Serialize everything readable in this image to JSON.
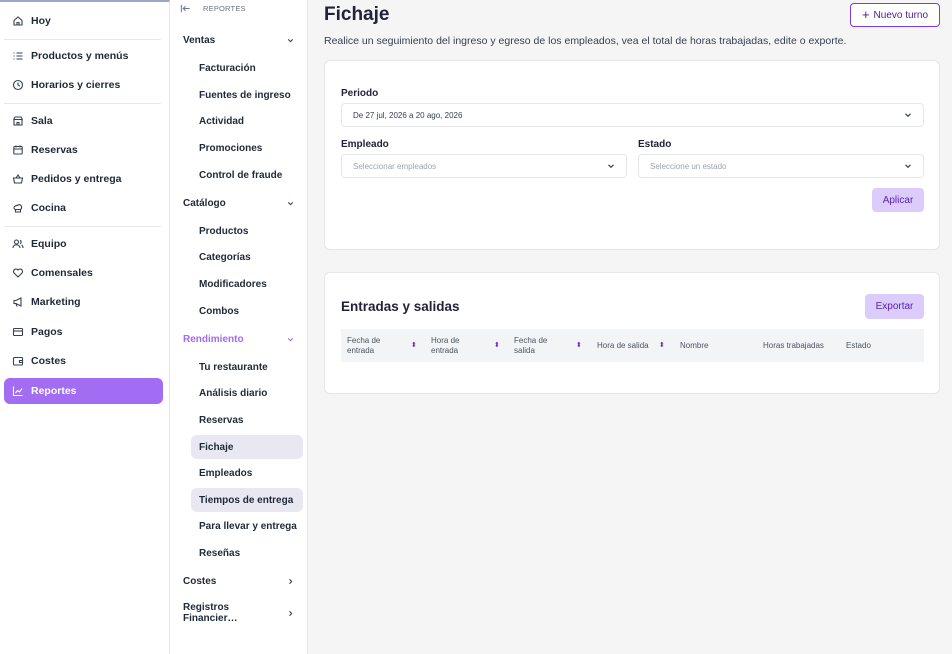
{
  "nav": {
    "items": [
      {
        "label": "Hoy",
        "icon": "home-icon"
      },
      {
        "label": "Productos y menús",
        "icon": "list-icon"
      },
      {
        "label": "Horarios y cierres",
        "icon": "clock-icon"
      },
      {
        "label": "Sala",
        "icon": "store-icon"
      },
      {
        "label": "Reservas",
        "icon": "calendar-icon"
      },
      {
        "label": "Pedidos y entrega",
        "icon": "basket-icon"
      },
      {
        "label": "Cocina",
        "icon": "chef-hat-icon"
      },
      {
        "label": "Equipo",
        "icon": "users-icon"
      },
      {
        "label": "Comensales",
        "icon": "heart-icon"
      },
      {
        "label": "Marketing",
        "icon": "megaphone-icon"
      },
      {
        "label": "Pagos",
        "icon": "card-icon"
      },
      {
        "label": "Costes",
        "icon": "wallet-icon"
      },
      {
        "label": "Reportes",
        "icon": "chart-icon"
      }
    ],
    "active_color": "#a26cf3"
  },
  "subnav": {
    "header": "REPORTES",
    "sections": {
      "ventas": "Ventas",
      "catalogo": "Catálogo",
      "rendimiento": "Rendimiento",
      "costes": "Costes",
      "registros": "Registros Financier…"
    },
    "ventas_items": [
      "Facturación",
      "Fuentes de ingreso",
      "Actividad",
      "Promociones",
      "Control de fraude"
    ],
    "catalogo_items": [
      "Productos",
      "Categorías",
      "Modificadores",
      "Combos"
    ],
    "rendimiento_items": [
      "Tu restaurante",
      "Análisis diario",
      "Reservas",
      "Fichaje",
      "Empleados",
      "Tiempos de entrega",
      "Para llevar y entrega",
      "Reseñas"
    ]
  },
  "page": {
    "title": "Fichaje",
    "subtitle": "Realice un seguimiento del ingreso y egreso de los empleados, vea el total de horas trabajadas, edite o exporte.",
    "new_button": "Nuevo turno"
  },
  "filters": {
    "periodo_label": "Periodo",
    "periodo_value": "De 27 jul, 2026 a 20 ago, 2026",
    "empleado_label": "Empleado",
    "empleado_placeholder": "Seleccionar empleados",
    "estado_label": "Estado",
    "estado_placeholder": "Seleccione un estado",
    "apply": "Aplicar"
  },
  "table": {
    "title": "Entradas y salidas",
    "export": "Exportar",
    "columns": [
      {
        "label": "Fecha de\nentrada",
        "sortable": true
      },
      {
        "label": "Hora de\nentrada",
        "sortable": true
      },
      {
        "label": "Fecha de\nsalida",
        "sortable": true
      },
      {
        "label": "Hora de salida",
        "sortable": true
      },
      {
        "label": "Nombre",
        "sortable": false
      },
      {
        "label": "Horas trabajadas",
        "sortable": false
      },
      {
        "label": "Estado",
        "sortable": false
      }
    ]
  }
}
